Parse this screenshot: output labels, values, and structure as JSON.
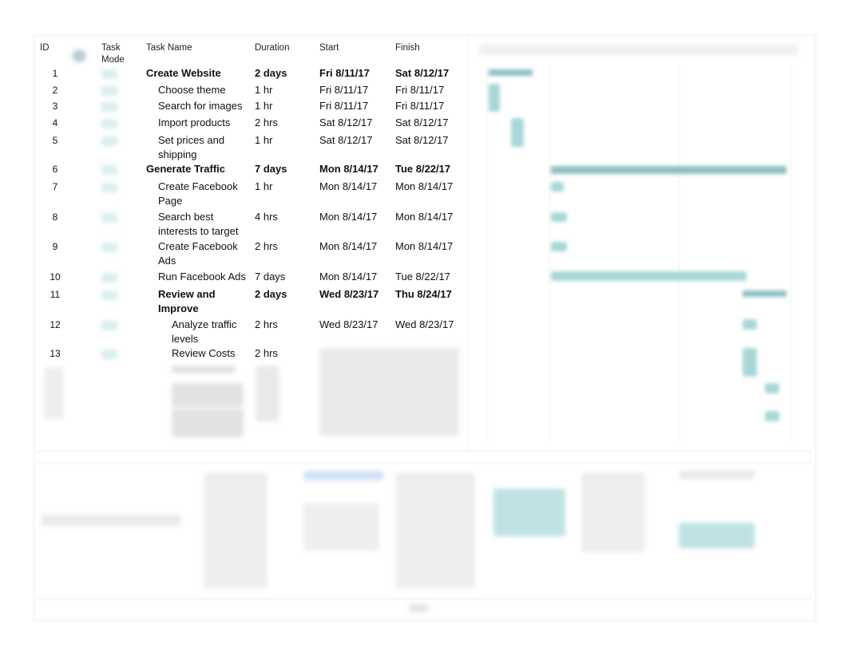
{
  "headers": {
    "id": "ID",
    "mode": "Task Mode",
    "name": "Task Name",
    "duration": "Duration",
    "start": "Start",
    "finish": "Finish"
  },
  "tasks": [
    {
      "id": "1",
      "name": "Create Website",
      "duration": "2 days",
      "start": "Fri 8/11/17",
      "finish": "Sat 8/12/17",
      "level": 0,
      "summary": true
    },
    {
      "id": "2",
      "name": "Choose theme",
      "duration": "1 hr",
      "start": "Fri 8/11/17",
      "finish": "Fri 8/11/17",
      "level": 1,
      "summary": false
    },
    {
      "id": "3",
      "name": "Search for images",
      "duration": "1 hr",
      "start": "Fri 8/11/17",
      "finish": "Fri 8/11/17",
      "level": 1,
      "summary": false
    },
    {
      "id": "4",
      "name": "Import products",
      "duration": "2 hrs",
      "start": "Sat 8/12/17",
      "finish": "Sat 8/12/17",
      "level": 1,
      "summary": false
    },
    {
      "id": "5",
      "name": "Set prices and shipping",
      "duration": "1 hr",
      "start": "Sat 8/12/17",
      "finish": "Sat 8/12/17",
      "level": 1,
      "summary": false
    },
    {
      "id": "6",
      "name": "Generate Traffic",
      "duration": "7 days",
      "start": "Mon 8/14/17",
      "finish": "Tue 8/22/17",
      "level": 0,
      "summary": true
    },
    {
      "id": "7",
      "name": "Create Facebook Page",
      "duration": "1 hr",
      "start": "Mon 8/14/17",
      "finish": "Mon 8/14/17",
      "level": 1,
      "summary": false
    },
    {
      "id": "8",
      "name": "Search best interests to target",
      "duration": "4 hrs",
      "start": "Mon 8/14/17",
      "finish": "Mon 8/14/17",
      "level": 1,
      "summary": false
    },
    {
      "id": "9",
      "name": "Create Facebook Ads",
      "duration": "2 hrs",
      "start": "Mon 8/14/17",
      "finish": "Mon 8/14/17",
      "level": 1,
      "summary": false
    },
    {
      "id": "10",
      "name": "Run Facebook Ads",
      "duration": "7 days",
      "start": "Mon 8/14/17",
      "finish": "Tue 8/22/17",
      "level": 1,
      "summary": false
    },
    {
      "id": "11",
      "name": "Review and Improve",
      "duration": "2 days",
      "start": "Wed 8/23/17",
      "finish": "Thu 8/24/17",
      "level": 1,
      "summary": true
    },
    {
      "id": "12",
      "name": "Analyze traffic levels",
      "duration": "2 hrs",
      "start": "Wed 8/23/17",
      "finish": "Wed 8/23/17",
      "level": 2,
      "summary": false
    },
    {
      "id": "13",
      "name": "Review Costs",
      "duration": "2 hrs",
      "start": "",
      "finish": "",
      "level": 2,
      "summary": false
    }
  ],
  "colors": {
    "task_bar": "#a9d7d8",
    "summary_bar": "#8fbfc4"
  }
}
